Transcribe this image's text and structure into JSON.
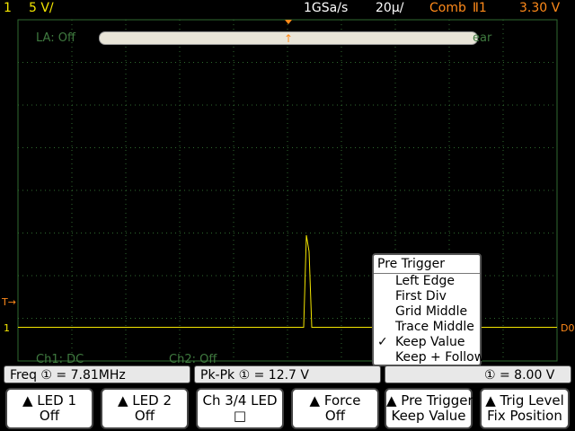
{
  "topbar": {
    "channel_number": "1",
    "channel_scale": "5 V/",
    "sample_rate": "1GSa/s",
    "time_scale": "20µ/",
    "mode": "Comb",
    "trigger": "Ⅱ1",
    "trigger_level": "3.30 V"
  },
  "overlay": {
    "la_label": "LA: Off",
    "clear_label": "ear",
    "zoom_marker": "↑"
  },
  "markers": {
    "ch1_ground": "1",
    "trigger_arrow": "T→",
    "right_offscreen": "D0"
  },
  "channel_labels": {
    "ch1": "Ch1: DC",
    "ch2": "Ch2: Off"
  },
  "measurements": [
    {
      "label": "Freq ① =  7.81MHz"
    },
    {
      "label": "Pk-Pk ① = 12.7  V"
    },
    {
      "label": "① =  8.00  V"
    }
  ],
  "softkeys": [
    {
      "line1": "▲ LED 1",
      "line2": "Off"
    },
    {
      "line1": "▲ LED 2",
      "line2": "Off"
    },
    {
      "line1": "Ch 3/4 LED",
      "line2": "□"
    },
    {
      "line1": "▲ Force",
      "line2": "Off"
    },
    {
      "line1": "▲ Pre Trigger",
      "line2": "Keep Value"
    },
    {
      "line1": "▲ Trig Level",
      "line2": "Fix Position"
    }
  ],
  "pretrigger_menu": {
    "title": "Pre Trigger",
    "items": [
      {
        "label": "Left Edge",
        "checked": false
      },
      {
        "label": "First Div",
        "checked": false
      },
      {
        "label": "Grid Middle",
        "checked": false
      },
      {
        "label": "Trace Middle",
        "checked": false
      },
      {
        "label": "Keep Value",
        "checked": true
      },
      {
        "label": "Keep + Follow",
        "checked": false
      }
    ],
    "check_mark": "✓"
  },
  "colors": {
    "channel1": "#f4e600",
    "trigger_orange": "#ff8a1a",
    "grid": "#2f6a2f"
  }
}
